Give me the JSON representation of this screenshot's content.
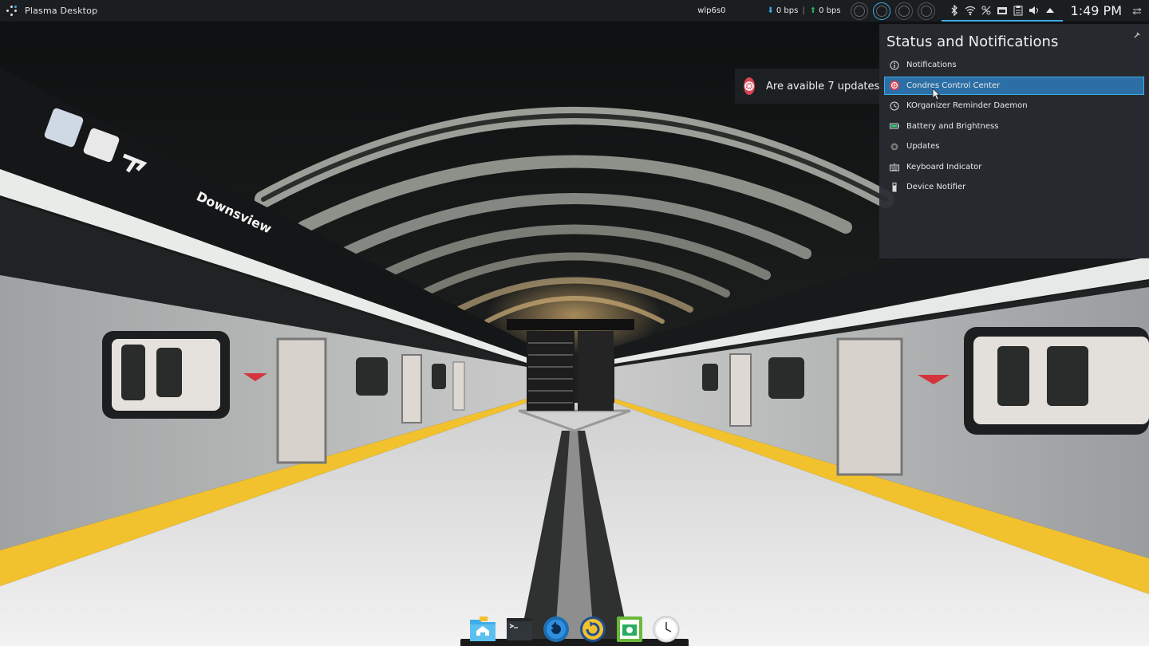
{
  "panel": {
    "title": "Plasma Desktop",
    "network_interface": "wlp6s0",
    "download_speed": "0 bps",
    "upload_speed": "0 bps",
    "separator": "|",
    "clock": "1:49 PM",
    "tray_icons": [
      "bluetooth-icon",
      "wifi-icon",
      "network-icon",
      "folder-icon",
      "clipboard-icon",
      "volume-icon",
      "expand-tray-icon"
    ]
  },
  "notification": {
    "text": "Are avaible 7 updates..."
  },
  "popup": {
    "title": "Status and Notifications",
    "items": [
      {
        "label": "Notifications",
        "icon": "info-icon"
      },
      {
        "label": "Condres Control Center",
        "icon": "condres-icon"
      },
      {
        "label": "KOrganizer Reminder Daemon",
        "icon": "clock-icon"
      },
      {
        "label": "Battery and Brightness",
        "icon": "battery-icon"
      },
      {
        "label": "Updates",
        "icon": "updates-gear-icon"
      },
      {
        "label": "Keyboard Indicator",
        "icon": "keyboard-icon"
      },
      {
        "label": "Device Notifier",
        "icon": "usb-device-icon"
      }
    ]
  },
  "dock": {
    "items": [
      "home-folder-icon",
      "terminal-icon",
      "system-update-icon",
      "backup-icon",
      "screenshot-icon",
      "clock-app-icon"
    ]
  },
  "colors": {
    "accent": "#3daee9",
    "selected": "#2c6fa6",
    "condres_red": "#da4453",
    "platform_yellow": "#f2c12e"
  }
}
